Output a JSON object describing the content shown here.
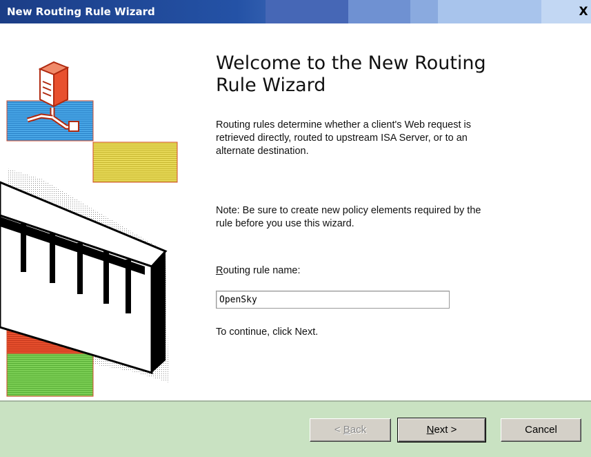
{
  "window": {
    "title": "New Routing Rule Wizard",
    "close_glyph": "X"
  },
  "main": {
    "heading_line1": "Welcome to the New Routing",
    "heading_line2": "Rule Wizard",
    "description_line1": "Routing rules determine whether a client's Web request is",
    "description_line2": "retrieved directly, routed to upstream ISA Server, or to an",
    "description_line3": "alternate destination.",
    "note_line1": "Note: Be sure to create new policy elements required by the",
    "note_line2": "rule before you use this wizard.",
    "name_label_accel": "R",
    "name_label_rest": "outing rule name:",
    "name_value": "OpenSky",
    "continue_text": "To continue, click Next."
  },
  "buttons": {
    "back_accel": "B",
    "back_prefix": "< ",
    "back_rest": "ack",
    "next_accel": "N",
    "next_rest": "ext >",
    "cancel_label": "Cancel"
  },
  "colors": {
    "titlebar_dark": "#1b3d86",
    "footer": "#c9e2c2",
    "illustration_blue": "#49a6e6",
    "illustration_yellow": "#e8da58",
    "illustration_red": "#e8502e",
    "illustration_green": "#7ccf55"
  },
  "icons": [
    "server-icon",
    "network-cable-icon"
  ]
}
